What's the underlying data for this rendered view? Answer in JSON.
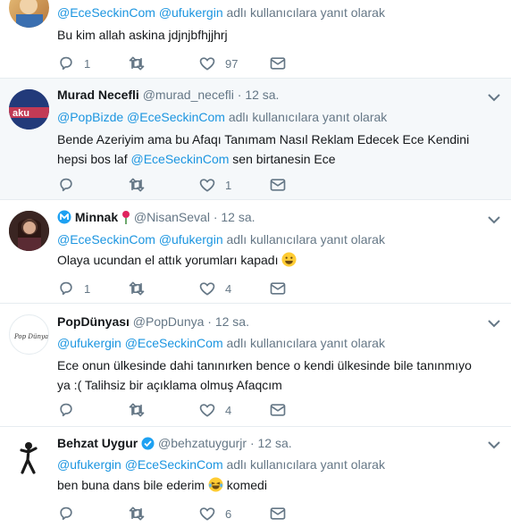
{
  "reply_prefix": "adlı kullanıcılara yanıt olarak",
  "tweets": [
    {
      "name": "",
      "handle": "",
      "time": "",
      "mentions": [
        "@EceSeckinCom",
        "@ufukergin"
      ],
      "text": "Bu kim allah askina jdjnjbfhjjhrj",
      "replies": "1",
      "retweets": "",
      "likes": "97"
    },
    {
      "name": "Murad Necefli",
      "handle": "@murad_necefli",
      "dot": "·",
      "time": "12 sa.",
      "mentions": [
        "@PopBizde",
        "@EceSeckinCom"
      ],
      "text_before": "Bende Azeriyim ama bu Afaqı Tanımam Nasıl Reklam Edecek Ece Kendini hepsi bos laf ",
      "text_link": "@EceSeckinCom",
      "text_after": " sen birtanesin Ece",
      "avatar_text": "aku",
      "replies": "",
      "retweets": "",
      "likes": "1"
    },
    {
      "name": "Minnak",
      "handle": "@NisanSeval",
      "dot": "·",
      "time": "12 sa.",
      "mentions": [
        "@EceSeckinCom",
        "@ufukergin"
      ],
      "text": "Olaya ucundan el attık yorumları kapadı",
      "replies": "1",
      "retweets": "",
      "likes": "4"
    },
    {
      "name": "PopDünyası",
      "handle": "@PopDunya",
      "dot": "·",
      "time": "12 sa.",
      "mentions": [
        "@ufukergin",
        "@EceSeckinCom"
      ],
      "text": "Ece onun ülkesinde dahi tanınırken bence o kendi ülkesinde bile tanınmıyo ya :( Talihsiz bir açıklama olmuş Afaqcım",
      "avatar_text": "Pop Dünyası",
      "replies": "",
      "retweets": "",
      "likes": "4"
    },
    {
      "name": "Behzat Uygur",
      "handle": "@behzatuygurjr",
      "dot": "·",
      "time": "12 sa.",
      "mentions": [
        "@ufukergin",
        "@EceSeckinCom"
      ],
      "text_before": "ben buna dans bile ederim ",
      "text_after": " komedi",
      "replies": "",
      "retweets": "",
      "likes": "6"
    }
  ],
  "colors": {
    "link": "#1b95e0",
    "muted": "#657786",
    "verified": "#1da1f2",
    "highlight_bg": "#f5f8fa",
    "rose": "#e0245e"
  }
}
